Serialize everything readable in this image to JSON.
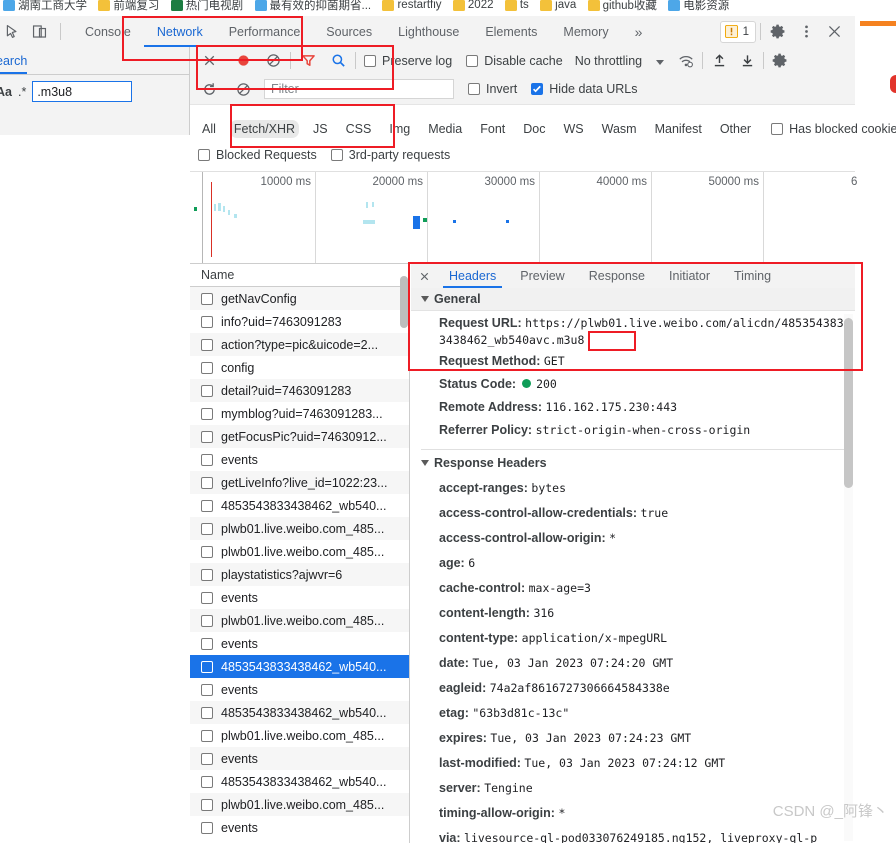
{
  "bookmarks": [
    {
      "label": "湖南工商大学",
      "icon": "bookmark-folder-icon",
      "color": "blue"
    },
    {
      "label": "前端复习",
      "icon": "bookmark-folder-icon",
      "color": "yellow"
    },
    {
      "label": "热门电视剧",
      "icon": "bookmark-folder-icon",
      "color": "green"
    },
    {
      "label": "最有效的抑菌期省...",
      "icon": "bookmark-folder-icon",
      "color": "tv"
    },
    {
      "label": "restartfiy",
      "icon": "bookmark-folder-icon",
      "color": "yellow"
    },
    {
      "label": "2022",
      "icon": "bookmark-folder-icon",
      "color": "yellow"
    },
    {
      "label": "ts",
      "icon": "bookmark-folder-icon",
      "color": "yellow"
    },
    {
      "label": "java",
      "icon": "bookmark-folder-icon",
      "color": "yellow"
    },
    {
      "label": "github收藏",
      "icon": "bookmark-folder-icon",
      "color": "yellow"
    },
    {
      "label": "电影资源",
      "icon": "bookmark-folder-icon",
      "color": "tv"
    }
  ],
  "devtools": {
    "tabs": [
      {
        "label": "Console",
        "active": false
      },
      {
        "label": "Network",
        "active": true
      },
      {
        "label": "Performance",
        "active": false
      },
      {
        "label": "Sources",
        "active": false
      },
      {
        "label": "Lighthouse",
        "active": false
      },
      {
        "label": "Elements",
        "active": false
      },
      {
        "label": "Memory",
        "active": false
      }
    ],
    "more_tabs_label": "»",
    "warning_count": "1",
    "settings_label": "gear-icon",
    "menu_label": "kebab-menu-icon",
    "close_label": "close-icon"
  },
  "search_panel": {
    "tab_label": "earch",
    "close_label": "×",
    "match_case_label": "Aa",
    "regex_label": ".*",
    "query_value": ".m3u8",
    "refresh_label": "refresh-icon",
    "clear_label": "clear-icon"
  },
  "network_toolbar": {
    "record_label": "record-button",
    "clear_label": "clear-button",
    "filter_toggle_label": "filter-icon",
    "search_label": "search-icon",
    "preserve_log_label": "Preserve log",
    "disable_cache_label": "Disable cache",
    "throttling_label": "No throttling",
    "throttle_conditions_label": "wifi-icon",
    "import_har_label": "import-har-icon",
    "export_har_label": "export-har-icon",
    "settings_label": "network-settings-icon",
    "filter_placeholder": "Filter",
    "invert_label": "Invert",
    "hide_data_urls_label": "Hide data URLs"
  },
  "type_filters": [
    {
      "label": "All",
      "selected": false
    },
    {
      "label": "Fetch/XHR",
      "selected": true
    },
    {
      "label": "JS",
      "selected": false
    },
    {
      "label": "CSS",
      "selected": false
    },
    {
      "label": "Img",
      "selected": false
    },
    {
      "label": "Media",
      "selected": false
    },
    {
      "label": "Font",
      "selected": false
    },
    {
      "label": "Doc",
      "selected": false
    },
    {
      "label": "WS",
      "selected": false
    },
    {
      "label": "Wasm",
      "selected": false
    },
    {
      "label": "Manifest",
      "selected": false
    },
    {
      "label": "Other",
      "selected": false
    }
  ],
  "extra_filters": {
    "has_blocked_cookies_label": "Has blocked cookies",
    "blocked_requests_label": "Blocked Requests",
    "third_party_label": "3rd-party requests"
  },
  "overview": {
    "ticks": [
      "10000 ms",
      "20000 ms",
      "30000 ms",
      "40000 ms",
      "50000 ms",
      "6 "
    ]
  },
  "requests": {
    "column_header": "Name",
    "rows": [
      {
        "name": "getNavConfig",
        "selected": false
      },
      {
        "name": "info?uid=7463091283",
        "selected": false
      },
      {
        "name": "action?type=pic&uicode=2...",
        "selected": false
      },
      {
        "name": "config",
        "selected": false
      },
      {
        "name": "detail?uid=7463091283",
        "selected": false
      },
      {
        "name": "mymblog?uid=7463091283...",
        "selected": false
      },
      {
        "name": "getFocusPic?uid=74630912...",
        "selected": false
      },
      {
        "name": "events",
        "selected": false
      },
      {
        "name": "getLiveInfo?live_id=1022:23...",
        "selected": false
      },
      {
        "name": "4853543833438462_wb540...",
        "selected": false
      },
      {
        "name": "plwb01.live.weibo.com_485...",
        "selected": false
      },
      {
        "name": "plwb01.live.weibo.com_485...",
        "selected": false
      },
      {
        "name": "playstatistics?ajwvr=6",
        "selected": false
      },
      {
        "name": "events",
        "selected": false
      },
      {
        "name": "plwb01.live.weibo.com_485...",
        "selected": false
      },
      {
        "name": "events",
        "selected": false
      },
      {
        "name": "4853543833438462_wb540...",
        "selected": true
      },
      {
        "name": "events",
        "selected": false
      },
      {
        "name": "4853543833438462_wb540...",
        "selected": false
      },
      {
        "name": "plwb01.live.weibo.com_485...",
        "selected": false
      },
      {
        "name": "events",
        "selected": false
      },
      {
        "name": "4853543833438462_wb540...",
        "selected": false
      },
      {
        "name": "plwb01.live.weibo.com_485...",
        "selected": false
      },
      {
        "name": "events",
        "selected": false
      }
    ]
  },
  "detail": {
    "close_label": "×",
    "tabs": [
      {
        "label": "Headers",
        "active": true
      },
      {
        "label": "Preview",
        "active": false
      },
      {
        "label": "Response",
        "active": false
      },
      {
        "label": "Initiator",
        "active": false
      },
      {
        "label": "Timing",
        "active": false
      }
    ],
    "general": {
      "section_title": "General",
      "request_url_key": "Request URL:",
      "request_url_value": "https://plwb01.live.weibo.com/alicdn/4853543833438462_wb540avc.m3u8",
      "request_method_key": "Request Method:",
      "request_method_value": "GET",
      "status_code_key": "Status Code:",
      "status_code_value": "200",
      "remote_address_key": "Remote Address:",
      "remote_address_value": "116.162.175.230:443",
      "referrer_policy_key": "Referrer Policy:",
      "referrer_policy_value": "strict-origin-when-cross-origin"
    },
    "response_headers": {
      "section_title": "Response Headers",
      "items": [
        {
          "key": "accept-ranges:",
          "value": "bytes"
        },
        {
          "key": "access-control-allow-credentials:",
          "value": "true"
        },
        {
          "key": "access-control-allow-origin:",
          "value": "*"
        },
        {
          "key": "age:",
          "value": "6"
        },
        {
          "key": "cache-control:",
          "value": "max-age=3"
        },
        {
          "key": "content-length:",
          "value": "316"
        },
        {
          "key": "content-type:",
          "value": "application/x-mpegURL"
        },
        {
          "key": "date:",
          "value": "Tue, 03 Jan 2023 07:24:20 GMT"
        },
        {
          "key": "eagleid:",
          "value": "74a2af8616727306664584338e"
        },
        {
          "key": "etag:",
          "value": "\"63b3d81c-13c\""
        },
        {
          "key": "expires:",
          "value": "Tue, 03 Jan 2023 07:24:23 GMT"
        },
        {
          "key": "last-modified:",
          "value": "Tue, 03 Jan 2023 07:24:12 GMT"
        },
        {
          "key": "server:",
          "value": "Tengine"
        },
        {
          "key": "timing-allow-origin:",
          "value": "*"
        },
        {
          "key": "via:",
          "value": "livesource-ql-pod033076249185.ng152, liveproxy-ql-p"
        }
      ]
    }
  },
  "annotations": {
    "highlight_color": "#ee1c25",
    "boxes": [
      {
        "name": "network-performance-tabs-highlight"
      },
      {
        "name": "record-filter-toolbar-highlight"
      },
      {
        "name": "fetch-xhr-type-filter-highlight"
      },
      {
        "name": "request-url-general-highlight"
      },
      {
        "name": "m3u8-extension-highlight"
      }
    ]
  },
  "watermark": "CSDN @_阿锋丶"
}
